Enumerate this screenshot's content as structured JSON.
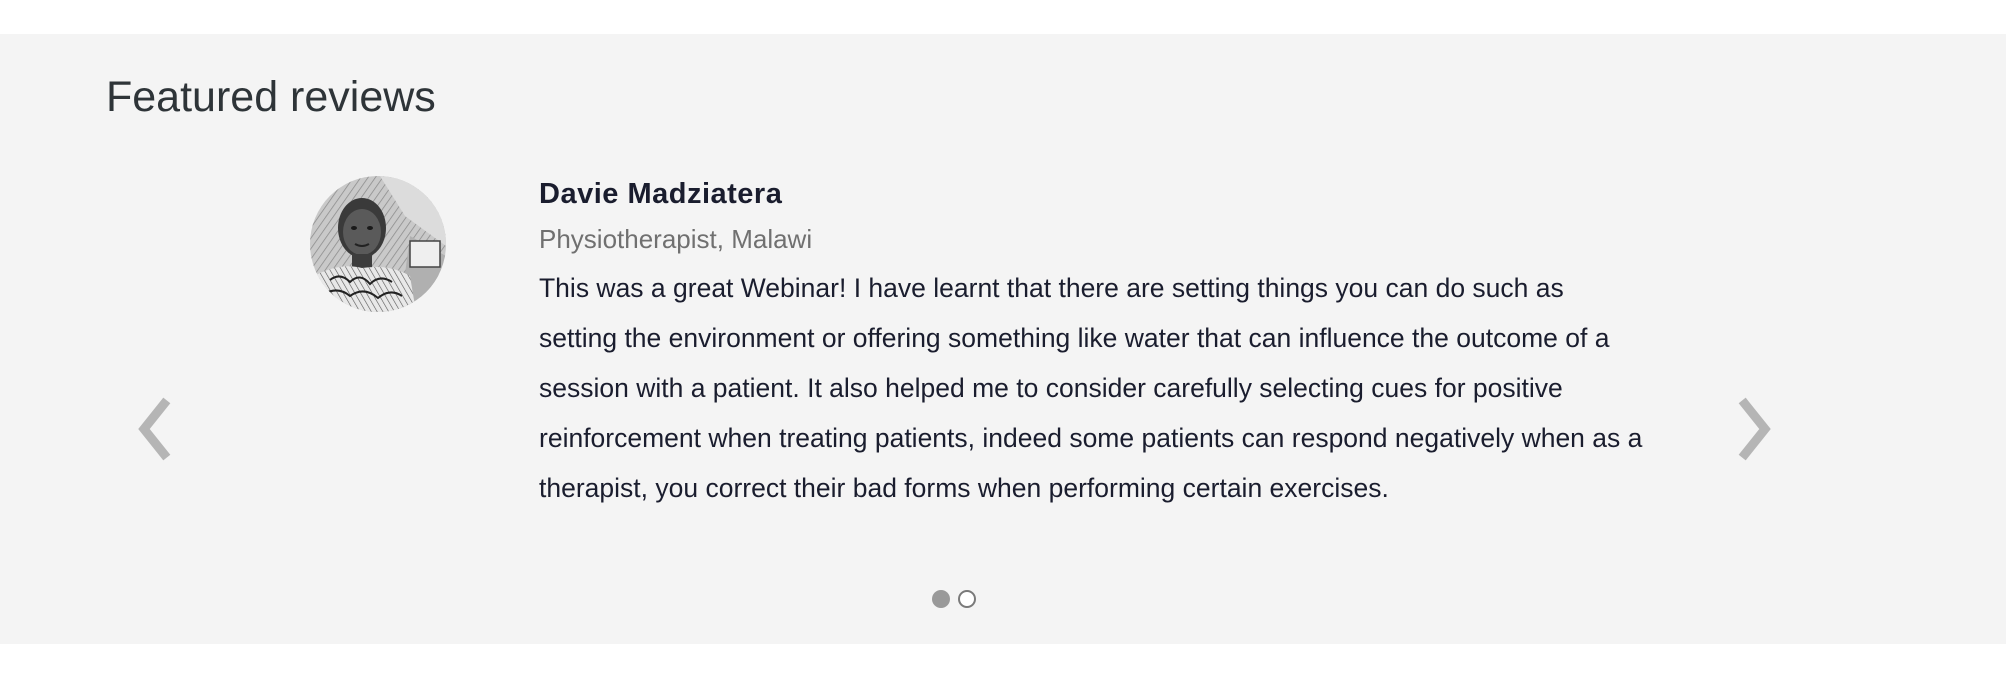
{
  "section": {
    "title": "Featured reviews"
  },
  "carousel": {
    "prev_icon": "chevron-left-icon",
    "next_icon": "chevron-right-icon",
    "arrow_color": "#b5b5b5",
    "slide_count": 2,
    "active_slide": 1
  },
  "review": {
    "name": "Davie Madziatera",
    "role": "Physiotherapist, Malawi",
    "text": "This was a great Webinar! I have learnt that there are setting things you can do such as setting the environment or offering something like water that can influence the outcome of a session with a patient. It also helped me to consider carefully selecting cues for positive reinforcement when treating patients, indeed some patients can respond negatively when as a therapist, you correct their bad forms when performing certain exercises.",
    "avatar": "reviewer-photo"
  }
}
